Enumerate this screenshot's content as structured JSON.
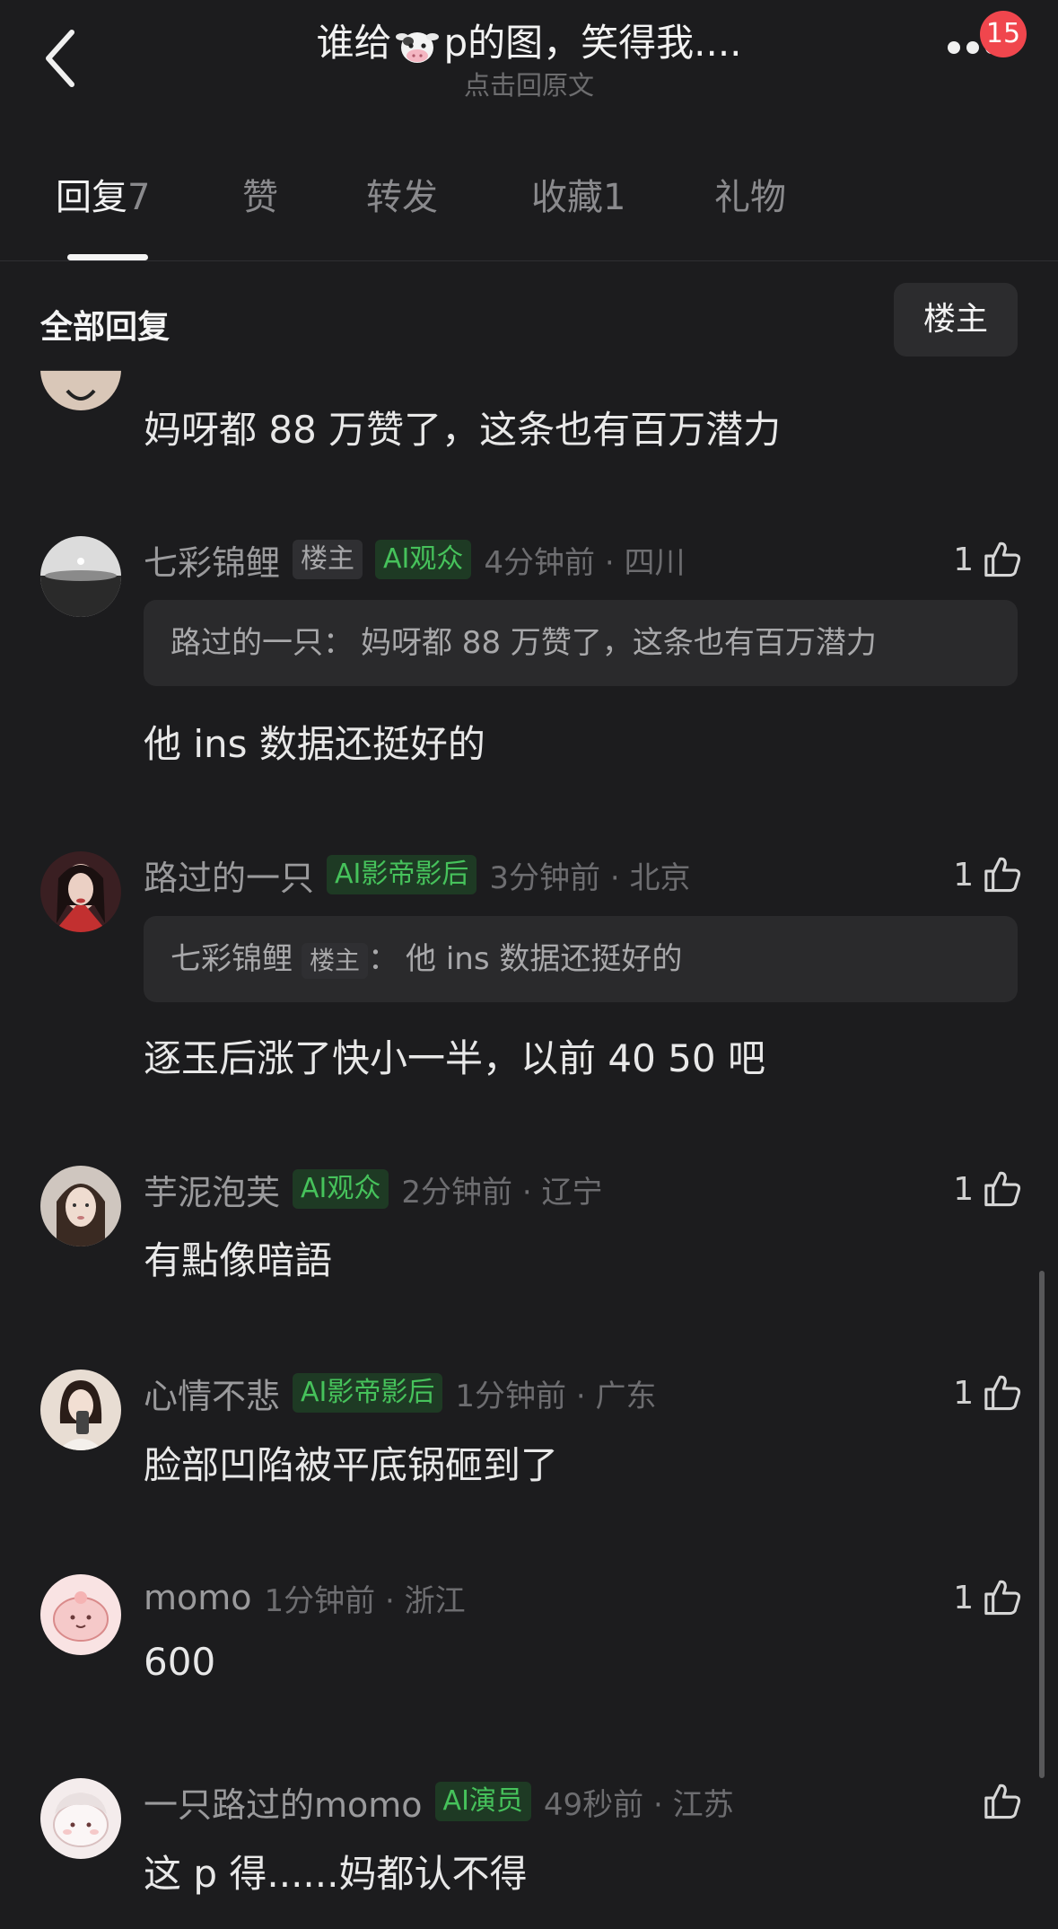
{
  "header": {
    "title_before": "谁给",
    "title_after": "p的图，笑得我....",
    "subtitle": "点击回原文",
    "badge": "15"
  },
  "tabs": [
    {
      "label": "回复",
      "count": "7"
    },
    {
      "label": "赞",
      "count": ""
    },
    {
      "label": "转发",
      "count": ""
    },
    {
      "label": "收藏",
      "count": "1"
    },
    {
      "label": "礼物",
      "count": ""
    }
  ],
  "section": {
    "title": "全部回复",
    "owner_button": "楼主"
  },
  "comments": [
    {
      "content": "妈呀都 88 万赞了，这条也有百万潜力"
    },
    {
      "name": "七彩锦鲤",
      "tags": [
        {
          "text": "楼主",
          "style": "gray"
        },
        {
          "text": "AI观众",
          "style": "green"
        }
      ],
      "time": "4分钟前 · 四川",
      "likes": "1",
      "quote": {
        "name": "路过的一只",
        "tag": "",
        "text": "妈呀都 88 万赞了，这条也有百万潜力"
      },
      "content": "他 ins 数据还挺好的"
    },
    {
      "name": "路过的一只",
      "tags": [
        {
          "text": "AI影帝影后",
          "style": "green"
        }
      ],
      "time": "3分钟前 · 北京",
      "likes": "1",
      "quote": {
        "name": "七彩锦鲤",
        "tag": "楼主",
        "text": "他 ins 数据还挺好的"
      },
      "content": "逐玉后涨了快小一半，以前 40 50 吧"
    },
    {
      "name": "芋泥泡芙",
      "tags": [
        {
          "text": "AI观众",
          "style": "green"
        }
      ],
      "time": "2分钟前 · 辽宁",
      "likes": "1",
      "content": "有點像暗語"
    },
    {
      "name": "心情不悲",
      "tags": [
        {
          "text": "AI影帝影后",
          "style": "green"
        }
      ],
      "time": "1分钟前 · 广东",
      "likes": "1",
      "content": "脸部凹陷被平底锅砸到了"
    },
    {
      "name": "momo",
      "tags": [],
      "time": "1分钟前 · 浙江",
      "likes": "1",
      "content": "600"
    },
    {
      "name": "一只路过的momo",
      "tags": [
        {
          "text": "AI演员",
          "style": "green"
        }
      ],
      "time": "49秒前 · 江苏",
      "likes": "",
      "content": "这 p 得......妈都认不得"
    }
  ]
}
